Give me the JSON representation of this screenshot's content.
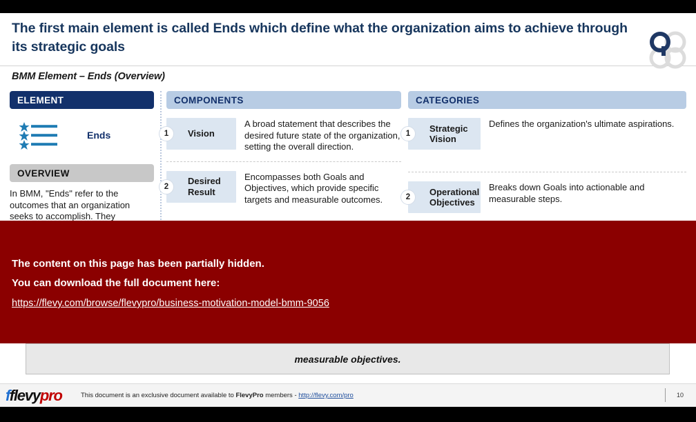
{
  "slide": {
    "title": "The first main element is called Ends which define what the organization aims to achieve through its strategic goals",
    "subtitle": "BMM Element – Ends (Overview)",
    "logo_name": "flevy-quadrant-logo"
  },
  "colors": {
    "title_navy": "#17365d",
    "element_header": "#12306b",
    "section_header": "#b8cce4",
    "overview_header": "#c8c8c8",
    "chip": "#dce6f1",
    "overlay_red": "#8b0000",
    "icon_blue": "#1f7cb4"
  },
  "element_panel": {
    "header": "ELEMENT",
    "icon_name": "star-list-icon",
    "name": "Ends",
    "overview_header": "OVERVIEW",
    "overview_text": "In BMM, \"Ends\" refer to the outcomes that an organization seeks to accomplish. They represent the \"what\" rather"
  },
  "components_panel": {
    "header": "COMPONENTS",
    "rows": [
      {
        "num": "1",
        "label": "Vision",
        "desc": "A broad statement that describes the desired future state of the organization, setting the overall direction."
      },
      {
        "num": "2",
        "label": "Desired Result",
        "desc": "Encompasses both Goals and Objectives, which provide specific targets and measurable outcomes."
      }
    ]
  },
  "categories_panel": {
    "header": "CATEGORIES",
    "rows": [
      {
        "num": "1",
        "label": "Strategic Vision",
        "desc": "Defines the organization's ultimate aspirations."
      },
      {
        "num": "2",
        "label": "Operational Objectives",
        "desc": "Breaks down Goals into actionable and measurable steps."
      }
    ]
  },
  "bottom_box": {
    "text": "measurable objectives."
  },
  "overlay": {
    "line1": "The content on this page has been partially hidden.",
    "line2": "You can download the full document here:",
    "link": "https://flevy.com/browse/flevypro/business-motivation-model-bmm-9056"
  },
  "footer": {
    "logo_part1": "flevy",
    "logo_part2": "pro",
    "text_before": "This document is an exclusive document available to ",
    "brand": "FlevyPro",
    "text_after": " members - ",
    "link": "http://flevy.com/pro",
    "page_number": "10"
  }
}
